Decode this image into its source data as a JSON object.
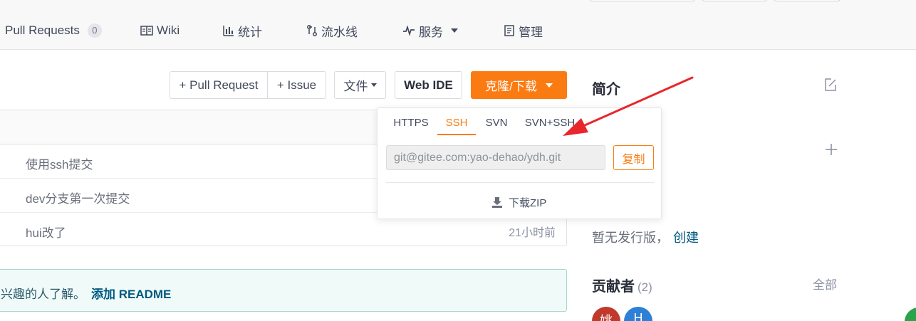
{
  "nav": {
    "pull_requests": "Pull Requests",
    "pull_requests_count": "0",
    "wiki": "Wiki",
    "stats": "统计",
    "pipeline": "流水线",
    "services": "服务",
    "manage": "管理"
  },
  "toolbar": {
    "pull_request": "+ Pull Request",
    "issue": "+ Issue",
    "file": "文件",
    "web_ide": "Web IDE",
    "clone": "克隆/下载"
  },
  "commits": [
    {
      "message": "使用ssh提交",
      "time": ""
    },
    {
      "message": "dev分支第一次提交",
      "time": ""
    },
    {
      "message": "hui改了",
      "time": "21小时前"
    }
  ],
  "readme": {
    "text": "兴趣的人了解。",
    "link": "添加 README"
  },
  "clone_panel": {
    "tabs": [
      "HTTPS",
      "SSH",
      "SVN",
      "SVN+SSH"
    ],
    "active_tab": "SSH",
    "url_value": "git@gitee.com:yao-dehao/ydh.git",
    "copy": "复制",
    "download_zip": "下载ZIP"
  },
  "sidebar": {
    "intro_title": "简介",
    "no_release": "暂无发行版，",
    "create": "创建",
    "contributors_title": "贡献者",
    "contributors_count": "(2)",
    "all": "全部",
    "avatars": [
      {
        "initial": "姚",
        "color": "#c0392b"
      },
      {
        "initial": "H",
        "color": "#2e7fd6"
      }
    ]
  },
  "colors": {
    "accent": "#fb7b13",
    "link": "#005980",
    "annotation_arrow": "#e8262b"
  }
}
